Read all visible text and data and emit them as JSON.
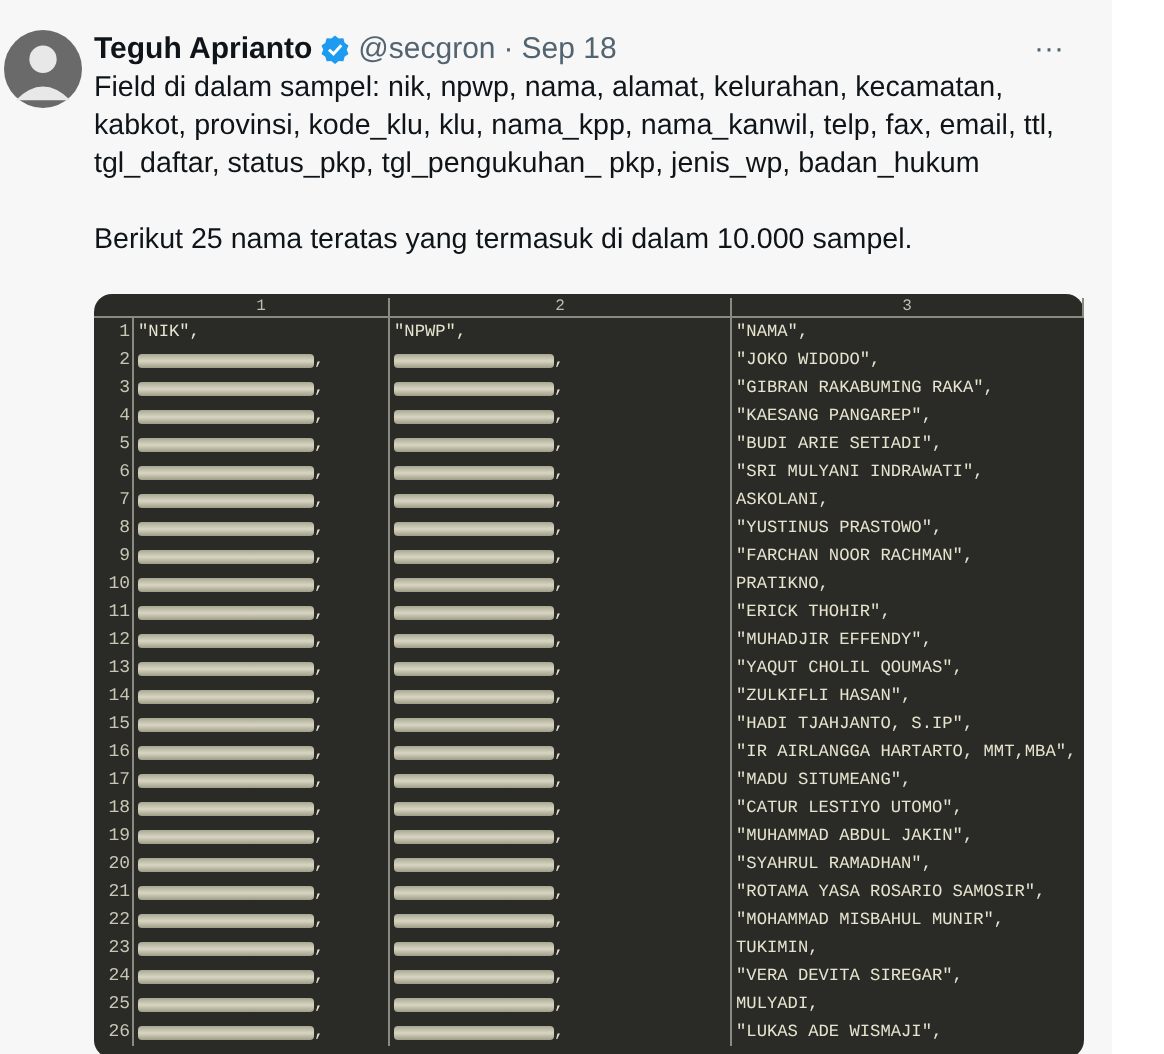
{
  "post": {
    "author": "Teguh Aprianto",
    "verified": true,
    "handle": "@secgron",
    "separator": "·",
    "date": "Sep 18",
    "more": "···",
    "paragraphs": [
      "Field di dalam sampel: nik, npwp, nama, alamat, kelurahan, kecamatan,\nkabkot, provinsi, kode_klu, klu, nama_kpp, nama_kanwil, telp, fax, email, ttl,\ntgl_daftar, status_pkp, tgl_pengukuhan_ pkp, jenis_wp, badan_hukum",
      "Berikut 25 nama teratas yang termasuk di dalam 10.000 sampel."
    ]
  },
  "sheet": {
    "columns": [
      "1",
      "2",
      "3"
    ],
    "rows": [
      {
        "number": "1",
        "redacted": false,
        "nik": "\"NIK\",",
        "npwp": "\"NPWP\",",
        "nama": "\"NAMA\","
      },
      {
        "number": "2",
        "redacted": true,
        "nik": ",",
        "npwp": ",",
        "nama": "\"JOKO WIDODO\","
      },
      {
        "number": "3",
        "redacted": true,
        "nik": ",",
        "npwp": ",",
        "nama": "\"GIBRAN RAKABUMING RAKA\","
      },
      {
        "number": "4",
        "redacted": true,
        "nik": ",",
        "npwp": ",",
        "nama": "\"KAESANG PANGAREP\","
      },
      {
        "number": "5",
        "redacted": true,
        "nik": ",",
        "npwp": ",",
        "nama": "\"BUDI ARIE SETIADI\","
      },
      {
        "number": "6",
        "redacted": true,
        "nik": ",",
        "npwp": ",",
        "nama": "\"SRI MULYANI INDRAWATI\","
      },
      {
        "number": "7",
        "redacted": true,
        "nik": ",",
        "npwp": ",",
        "nama": "ASKOLANI,"
      },
      {
        "number": "8",
        "redacted": true,
        "nik": ",",
        "npwp": ",",
        "nama": "\"YUSTINUS PRASTOWO\","
      },
      {
        "number": "9",
        "redacted": true,
        "nik": ",",
        "npwp": ",",
        "nama": "\"FARCHAN NOOR RACHMAN\","
      },
      {
        "number": "10",
        "redacted": true,
        "nik": ",",
        "npwp": ",",
        "nama": "PRATIKNO,"
      },
      {
        "number": "11",
        "redacted": true,
        "nik": ",",
        "npwp": ",",
        "nama": "\"ERICK THOHIR\","
      },
      {
        "number": "12",
        "redacted": true,
        "nik": ",",
        "npwp": ",",
        "nama": "\"MUHADJIR EFFENDY\","
      },
      {
        "number": "13",
        "redacted": true,
        "nik": ",",
        "npwp": ",",
        "nama": "\"YAQUT CHOLIL QOUMAS\","
      },
      {
        "number": "14",
        "redacted": true,
        "nik": ",",
        "npwp": ",",
        "nama": "\"ZULKIFLI HASAN\","
      },
      {
        "number": "15",
        "redacted": true,
        "nik": ",",
        "npwp": ",",
        "nama": "\"HADI TJAHJANTO, S.IP\","
      },
      {
        "number": "16",
        "redacted": true,
        "nik": ",",
        "npwp": ",",
        "nama": "\"IR AIRLANGGA HARTARTO, MMT,MBA\","
      },
      {
        "number": "17",
        "redacted": true,
        "nik": ",",
        "npwp": ",",
        "nama": "\"MADU SITUMEANG\","
      },
      {
        "number": "18",
        "redacted": true,
        "nik": ",",
        "npwp": ",",
        "nama": "\"CATUR LESTIYO UTOMO\","
      },
      {
        "number": "19",
        "redacted": true,
        "nik": ",",
        "npwp": ",",
        "nama": "\"MUHAMMAD ABDUL JAKIN\","
      },
      {
        "number": "20",
        "redacted": true,
        "nik": ",",
        "npwp": ",",
        "nama": "\"SYAHRUL RAMADHAN\","
      },
      {
        "number": "21",
        "redacted": true,
        "nik": ",",
        "npwp": ",",
        "nama": "\"ROTAMA YASA ROSARIO SAMOSIR\","
      },
      {
        "number": "22",
        "redacted": true,
        "nik": ",",
        "npwp": ",",
        "nama": "\"MOHAMMAD MISBAHUL MUNIR\","
      },
      {
        "number": "23",
        "redacted": true,
        "nik": ",",
        "npwp": ",",
        "nama": "TUKIMIN,"
      },
      {
        "number": "24",
        "redacted": true,
        "nik": ",",
        "npwp": ",",
        "nama": "\"VERA DEVITA SIREGAR\","
      },
      {
        "number": "25",
        "redacted": true,
        "nik": ",",
        "npwp": ",",
        "nama": "MULYADI,"
      },
      {
        "number": "26",
        "redacted": true,
        "nik": ",",
        "npwp": ",",
        "nama": "\"LUKAS ADE WISMAJI\","
      }
    ]
  }
}
